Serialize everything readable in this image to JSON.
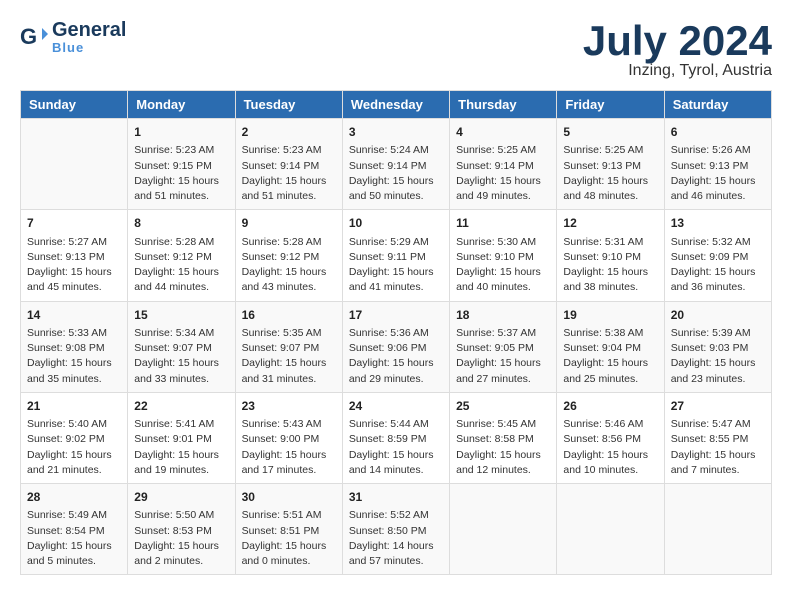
{
  "header": {
    "logo_general": "General",
    "logo_blue": "Blue",
    "title": "July 2024",
    "subtitle": "Inzing, Tyrol, Austria"
  },
  "days_of_week": [
    "Sunday",
    "Monday",
    "Tuesday",
    "Wednesday",
    "Thursday",
    "Friday",
    "Saturday"
  ],
  "weeks": [
    [
      {
        "day": "",
        "info": ""
      },
      {
        "day": "1",
        "info": "Sunrise: 5:23 AM\nSunset: 9:15 PM\nDaylight: 15 hours\nand 51 minutes."
      },
      {
        "day": "2",
        "info": "Sunrise: 5:23 AM\nSunset: 9:14 PM\nDaylight: 15 hours\nand 51 minutes."
      },
      {
        "day": "3",
        "info": "Sunrise: 5:24 AM\nSunset: 9:14 PM\nDaylight: 15 hours\nand 50 minutes."
      },
      {
        "day": "4",
        "info": "Sunrise: 5:25 AM\nSunset: 9:14 PM\nDaylight: 15 hours\nand 49 minutes."
      },
      {
        "day": "5",
        "info": "Sunrise: 5:25 AM\nSunset: 9:13 PM\nDaylight: 15 hours\nand 48 minutes."
      },
      {
        "day": "6",
        "info": "Sunrise: 5:26 AM\nSunset: 9:13 PM\nDaylight: 15 hours\nand 46 minutes."
      }
    ],
    [
      {
        "day": "7",
        "info": "Sunrise: 5:27 AM\nSunset: 9:13 PM\nDaylight: 15 hours\nand 45 minutes."
      },
      {
        "day": "8",
        "info": "Sunrise: 5:28 AM\nSunset: 9:12 PM\nDaylight: 15 hours\nand 44 minutes."
      },
      {
        "day": "9",
        "info": "Sunrise: 5:28 AM\nSunset: 9:12 PM\nDaylight: 15 hours\nand 43 minutes."
      },
      {
        "day": "10",
        "info": "Sunrise: 5:29 AM\nSunset: 9:11 PM\nDaylight: 15 hours\nand 41 minutes."
      },
      {
        "day": "11",
        "info": "Sunrise: 5:30 AM\nSunset: 9:10 PM\nDaylight: 15 hours\nand 40 minutes."
      },
      {
        "day": "12",
        "info": "Sunrise: 5:31 AM\nSunset: 9:10 PM\nDaylight: 15 hours\nand 38 minutes."
      },
      {
        "day": "13",
        "info": "Sunrise: 5:32 AM\nSunset: 9:09 PM\nDaylight: 15 hours\nand 36 minutes."
      }
    ],
    [
      {
        "day": "14",
        "info": "Sunrise: 5:33 AM\nSunset: 9:08 PM\nDaylight: 15 hours\nand 35 minutes."
      },
      {
        "day": "15",
        "info": "Sunrise: 5:34 AM\nSunset: 9:07 PM\nDaylight: 15 hours\nand 33 minutes."
      },
      {
        "day": "16",
        "info": "Sunrise: 5:35 AM\nSunset: 9:07 PM\nDaylight: 15 hours\nand 31 minutes."
      },
      {
        "day": "17",
        "info": "Sunrise: 5:36 AM\nSunset: 9:06 PM\nDaylight: 15 hours\nand 29 minutes."
      },
      {
        "day": "18",
        "info": "Sunrise: 5:37 AM\nSunset: 9:05 PM\nDaylight: 15 hours\nand 27 minutes."
      },
      {
        "day": "19",
        "info": "Sunrise: 5:38 AM\nSunset: 9:04 PM\nDaylight: 15 hours\nand 25 minutes."
      },
      {
        "day": "20",
        "info": "Sunrise: 5:39 AM\nSunset: 9:03 PM\nDaylight: 15 hours\nand 23 minutes."
      }
    ],
    [
      {
        "day": "21",
        "info": "Sunrise: 5:40 AM\nSunset: 9:02 PM\nDaylight: 15 hours\nand 21 minutes."
      },
      {
        "day": "22",
        "info": "Sunrise: 5:41 AM\nSunset: 9:01 PM\nDaylight: 15 hours\nand 19 minutes."
      },
      {
        "day": "23",
        "info": "Sunrise: 5:43 AM\nSunset: 9:00 PM\nDaylight: 15 hours\nand 17 minutes."
      },
      {
        "day": "24",
        "info": "Sunrise: 5:44 AM\nSunset: 8:59 PM\nDaylight: 15 hours\nand 14 minutes."
      },
      {
        "day": "25",
        "info": "Sunrise: 5:45 AM\nSunset: 8:58 PM\nDaylight: 15 hours\nand 12 minutes."
      },
      {
        "day": "26",
        "info": "Sunrise: 5:46 AM\nSunset: 8:56 PM\nDaylight: 15 hours\nand 10 minutes."
      },
      {
        "day": "27",
        "info": "Sunrise: 5:47 AM\nSunset: 8:55 PM\nDaylight: 15 hours\nand 7 minutes."
      }
    ],
    [
      {
        "day": "28",
        "info": "Sunrise: 5:49 AM\nSunset: 8:54 PM\nDaylight: 15 hours\nand 5 minutes."
      },
      {
        "day": "29",
        "info": "Sunrise: 5:50 AM\nSunset: 8:53 PM\nDaylight: 15 hours\nand 2 minutes."
      },
      {
        "day": "30",
        "info": "Sunrise: 5:51 AM\nSunset: 8:51 PM\nDaylight: 15 hours\nand 0 minutes."
      },
      {
        "day": "31",
        "info": "Sunrise: 5:52 AM\nSunset: 8:50 PM\nDaylight: 14 hours\nand 57 minutes."
      },
      {
        "day": "",
        "info": ""
      },
      {
        "day": "",
        "info": ""
      },
      {
        "day": "",
        "info": ""
      }
    ]
  ]
}
